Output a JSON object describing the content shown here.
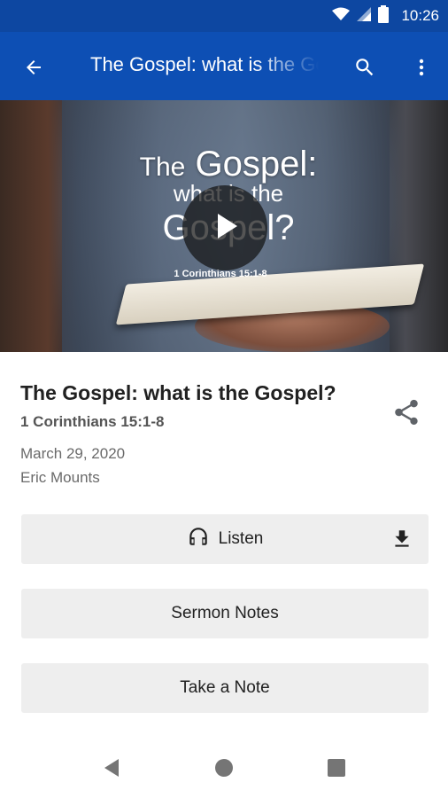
{
  "status_bar": {
    "time": "10:26",
    "icons": [
      "wifi-icon",
      "signal-icon",
      "battery-icon"
    ]
  },
  "app_bar": {
    "title": "The Gospel: what is the Gospel?",
    "icons": [
      "back-arrow-icon",
      "search-icon",
      "more-vert-icon"
    ],
    "color": "#0d4fb4"
  },
  "hero": {
    "title_line1_small": "The",
    "title_line1_large": "Gospel:",
    "title_line2": "what is the",
    "title_line3": "Gospel?",
    "reference": "1 Corinthians 15:1-8",
    "play_icon": "play-icon"
  },
  "sermon": {
    "title": "The Gospel: what is the Gospel?",
    "scripture": "1 Corinthians 15:1-8",
    "date": "March 29, 2020",
    "speaker": "Eric Mounts",
    "share_icon": "share-icon"
  },
  "actions": {
    "listen_label": "Listen",
    "listen_icon": "headphones-icon",
    "download_icon": "download-icon",
    "sermon_notes_label": "Sermon Notes",
    "take_note_label": "Take a Note"
  },
  "nav_bar": {
    "icons": [
      "nav-back-icon",
      "nav-home-icon",
      "nav-recents-icon"
    ]
  }
}
